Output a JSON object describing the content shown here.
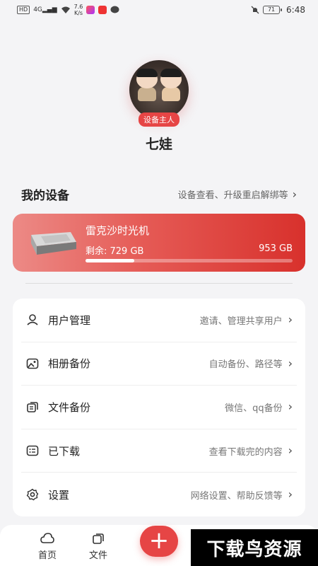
{
  "status_bar": {
    "network_chip": "HD",
    "signal_label": "4G",
    "speed_value": "7.6",
    "speed_unit": "K/s",
    "battery": "71",
    "time": "6:48"
  },
  "profile": {
    "badge": "设备主人",
    "username": "七娃"
  },
  "devices_section": {
    "title": "我的设备",
    "link": "设备查看、升级重启解绑等"
  },
  "device_card": {
    "name": "雷克沙时光机",
    "remaining": "剩余: 729 GB",
    "total": "953 GB",
    "used_fraction": 0.235
  },
  "menu": {
    "items": [
      {
        "label": "用户管理",
        "desc": "邀请、管理共享用户",
        "icon": "user-icon"
      },
      {
        "label": "相册备份",
        "desc": "自动备份、路径等",
        "icon": "photo-icon"
      },
      {
        "label": "文件备份",
        "desc": "微信、qq备份",
        "icon": "files-icon"
      },
      {
        "label": "已下载",
        "desc": "查看下载完的内容",
        "icon": "download-list-icon"
      },
      {
        "label": "设置",
        "desc": "网络设置、帮助反馈等",
        "icon": "gear-icon"
      }
    ]
  },
  "tab_bar": {
    "home": "首页",
    "files": "文件",
    "fab": "+"
  },
  "watermark": "下载鸟资源",
  "colors": {
    "accent": "#e64545",
    "card_gradient_start": "#ec8a86",
    "card_gradient_end": "#d8312c"
  }
}
